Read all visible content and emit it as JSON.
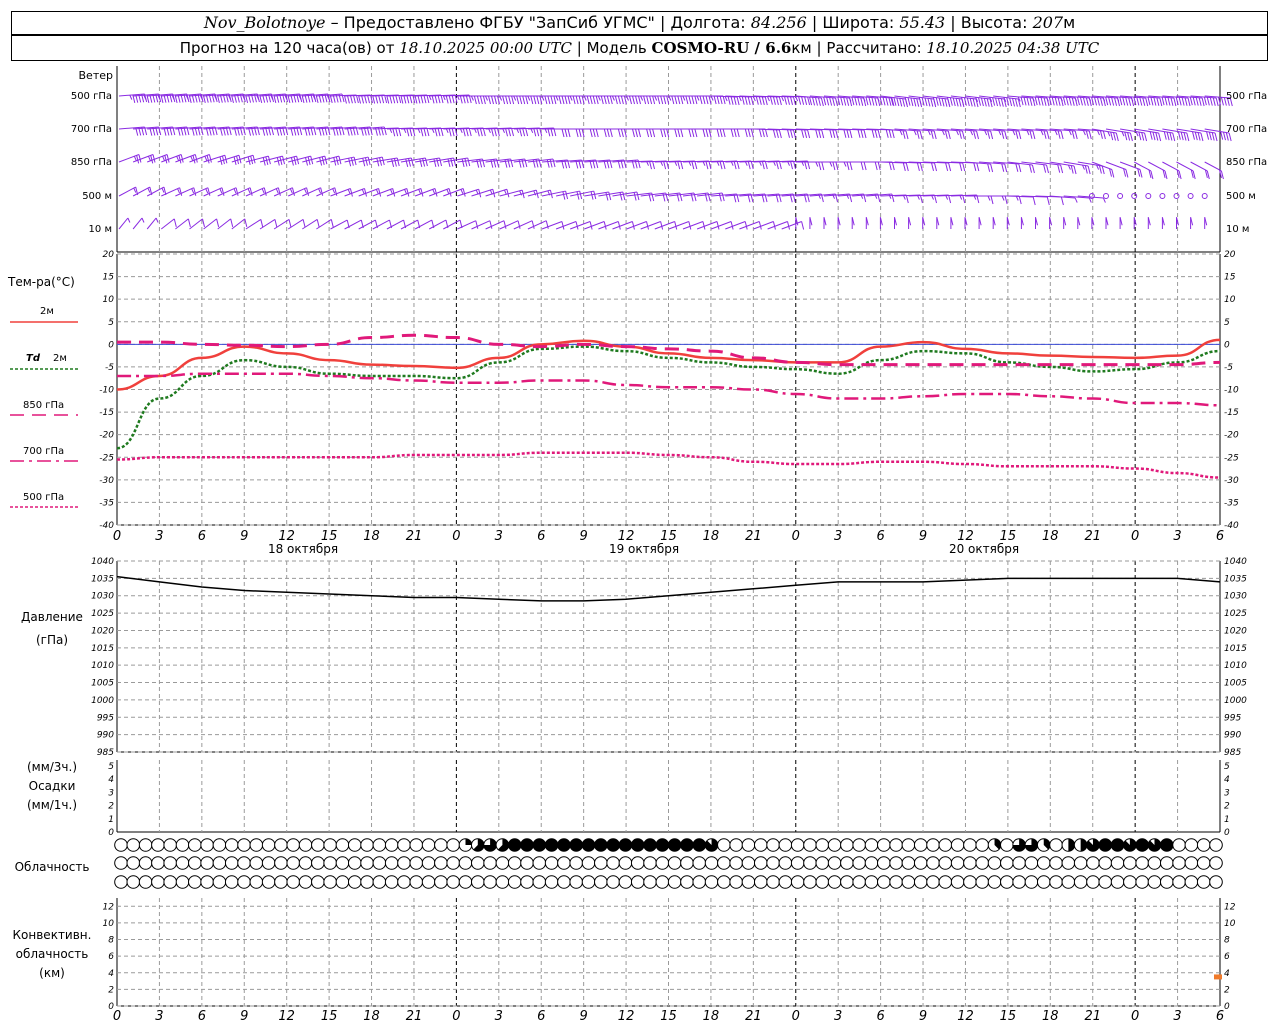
{
  "header": {
    "station": "Nov_Bolotnoye",
    "provider": " – Предоставлено ФГБУ \"ЗапСиб УГМС\" | Долгота: ",
    "lon": "84.256",
    "lat_label": " | Широта: ",
    "lat": "55.43",
    "alt_label": " | Высота: ",
    "alt": "207",
    "alt_unit": "м",
    "forecast_label": "Прогноз на 120 часа(ов) от ",
    "forecast_start": "18.10.2025 00:00 UTC",
    "model_label": " | Модель ",
    "model": "COSMO-RU / 6.6",
    "model_unit": "км",
    "calc_label": " | Рассчитано: ",
    "calc_time": "18.10.2025 04:38 UTC"
  },
  "colors": {
    "wind": "#8a2be2",
    "t2m": "#f0403c",
    "td2m": "#1f7a1f",
    "t850": "#e0197a",
    "t700": "#e0197a",
    "t500": "#e0197a",
    "pressure": "#000000",
    "zero_line": "#3b4bd6",
    "grid": "#9a9a9a",
    "convective": "#f07a2a"
  },
  "labels": {
    "wind": "Ветер",
    "temp": "Тем-ра(°С)",
    "t2m": "2м",
    "td": "Td",
    "td_h": "2м",
    "t850": "850 гПа",
    "t700": "700 гПа",
    "t500": "500 гПа",
    "pressure_1": "Давление",
    "pressure_2": "(гПа)",
    "precip_1": "(мм/3ч.)",
    "precip_2": "Осадки",
    "precip_3": "(мм/1ч.)",
    "cloud": "Облачность",
    "conv_1": "Конвективн.",
    "conv_2": "облачность",
    "conv_3": "(км)"
  },
  "wind_levels": [
    "500 гПа",
    "700 гПа",
    "850 гПа",
    "500 м",
    "10 м"
  ],
  "x_hours": [
    "0",
    "3",
    "6",
    "9",
    "12",
    "15",
    "18",
    "21",
    "0",
    "3",
    "6",
    "9",
    "12",
    "15",
    "18",
    "21",
    "0",
    "3",
    "6",
    "9",
    "12",
    "15",
    "18",
    "21",
    "0",
    "3",
    "6"
  ],
  "dates": [
    "18 октября",
    "19 октября",
    "20 октября"
  ],
  "chart_data": [
    {
      "type": "line",
      "title": "Температура",
      "ylabel": "Тем-ра(°С)",
      "ylim": [
        -40,
        20
      ],
      "yticks": [
        20,
        15,
        10,
        5,
        0,
        -5,
        -10,
        -15,
        -20,
        -25,
        -30,
        -35,
        -40
      ],
      "x_hours_from_start": [
        0,
        3,
        6,
        9,
        12,
        15,
        18,
        21,
        24,
        27,
        30,
        33,
        36,
        39,
        42,
        45,
        48,
        51,
        54,
        57,
        60,
        63,
        66,
        69,
        72,
        75,
        78
      ],
      "series": [
        {
          "name": "2м",
          "values": [
            -10,
            -7,
            -3,
            -0.5,
            -2,
            -3.5,
            -4.5,
            -4.8,
            -5.2,
            -3,
            0,
            0.8,
            -0.5,
            -2,
            -3,
            -3.5,
            -4,
            -4,
            -0.5,
            0.5,
            -1,
            -2,
            -2.5,
            -2.8,
            -3,
            -2.5,
            1
          ]
        },
        {
          "name": "Td 2м",
          "values": [
            -23,
            -12,
            -7,
            -3.5,
            -5,
            -6.5,
            -7,
            -7,
            -7.5,
            -4,
            -1,
            -0.5,
            -1.5,
            -3,
            -4,
            -5,
            -5.5,
            -6.5,
            -3.5,
            -1.5,
            -2,
            -4,
            -5,
            -6,
            -5.5,
            -4,
            -1.5
          ]
        },
        {
          "name": "850 гПа",
          "values": [
            0.5,
            0.5,
            0,
            -0.2,
            -0.5,
            0,
            1.5,
            2,
            1.5,
            0,
            -0.5,
            0,
            -0.5,
            -1,
            -1.5,
            -3,
            -4,
            -4.5,
            -4.5,
            -4.5,
            -4.5,
            -4.5,
            -4.5,
            -4.5,
            -4.5,
            -4.5,
            -4
          ]
        },
        {
          "name": "700 гПа",
          "values": [
            -7,
            -7,
            -6.5,
            -6.5,
            -6.5,
            -7,
            -7.5,
            -8,
            -8.5,
            -8.5,
            -8,
            -8,
            -9,
            -9.5,
            -9.5,
            -10,
            -11,
            -12,
            -12,
            -11.5,
            -11,
            -11,
            -11.5,
            -12,
            -13,
            -13,
            -13.5
          ]
        },
        {
          "name": "500 гПа",
          "values": [
            -25.5,
            -25,
            -25,
            -25,
            -25,
            -25,
            -25,
            -24.5,
            -24.5,
            -24.5,
            -24,
            -24,
            -24,
            -24.5,
            -25,
            -26,
            -26.5,
            -26.5,
            -26,
            -26,
            -26.5,
            -27,
            -27,
            -27,
            -27.5,
            -28.5,
            -29.5
          ]
        }
      ]
    },
    {
      "type": "line",
      "title": "Давление",
      "ylabel": "Давление (гПа)",
      "ylim": [
        985,
        1040
      ],
      "yticks": [
        1040,
        1035,
        1030,
        1025,
        1020,
        1015,
        1010,
        1005,
        1000,
        995,
        990,
        985
      ],
      "x_hours_from_start": [
        0,
        3,
        6,
        9,
        12,
        15,
        18,
        21,
        24,
        27,
        30,
        33,
        36,
        39,
        42,
        45,
        48,
        51,
        54,
        57,
        60,
        63,
        66,
        69,
        72,
        75,
        78
      ],
      "series": [
        {
          "name": "Давление",
          "values": [
            1035.5,
            1034,
            1032.5,
            1031.5,
            1031,
            1030.5,
            1030,
            1029.5,
            1029.5,
            1029,
            1028.5,
            1028.5,
            1029,
            1030,
            1031,
            1032,
            1033,
            1034,
            1034,
            1034,
            1034.5,
            1035,
            1035,
            1035,
            1035,
            1035,
            1034
          ]
        }
      ]
    },
    {
      "type": "bar",
      "title": "Осадки",
      "ylabel": "(мм/3ч.) Осадки (мм/1ч.)",
      "ylim": [
        0,
        5
      ],
      "yticks": [
        5,
        4,
        3,
        2,
        1,
        0
      ],
      "values": []
    },
    {
      "type": "bar",
      "title": "Конвективн. облачность",
      "ylabel": "(км)",
      "ylim": [
        0,
        13
      ],
      "yticks": [
        12,
        10,
        8,
        6,
        4,
        2,
        0
      ],
      "bars": [
        {
          "x_hour": 78,
          "bottom": 3.2,
          "top": 3.8
        }
      ]
    }
  ],
  "wind_barbs": {
    "note_levels": [
      "500 гПа",
      "700 гПа",
      "850 гПа",
      "500 м",
      "10 м"
    ],
    "rows": [
      {
        "level": "500 гПа",
        "speed": [
          55,
          55,
          55,
          55,
          55,
          50,
          50,
          45,
          45,
          45,
          45,
          45,
          45,
          45,
          45,
          45,
          50,
          55,
          60,
          60,
          55,
          55,
          55,
          55,
          50,
          50,
          55
        ],
        "dir": [
          260,
          260,
          260,
          260,
          260,
          265,
          265,
          265,
          270,
          270,
          270,
          270,
          270,
          270,
          275,
          275,
          280,
          280,
          285,
          285,
          285,
          280,
          280,
          280,
          280,
          280,
          280
        ]
      },
      {
        "level": "700 гПа",
        "speed": [
          40,
          40,
          40,
          40,
          40,
          40,
          35,
          35,
          35,
          35,
          30,
          30,
          30,
          30,
          30,
          30,
          30,
          30,
          25,
          25,
          25,
          25,
          25,
          35,
          40,
          40,
          40
        ],
        "dir": [
          260,
          260,
          260,
          260,
          260,
          260,
          265,
          265,
          265,
          265,
          270,
          270,
          270,
          270,
          270,
          275,
          275,
          275,
          280,
          280,
          280,
          280,
          280,
          290,
          290,
          290,
          285
        ]
      },
      {
        "level": "850 гПа",
        "speed": [
          25,
          25,
          30,
          30,
          30,
          30,
          30,
          30,
          30,
          30,
          30,
          30,
          25,
          25,
          25,
          25,
          25,
          20,
          20,
          20,
          20,
          20,
          25,
          20,
          20,
          20,
          15
        ],
        "dir": [
          230,
          230,
          235,
          240,
          240,
          245,
          250,
          250,
          255,
          255,
          260,
          260,
          265,
          265,
          265,
          265,
          270,
          270,
          275,
          275,
          280,
          285,
          290,
          310,
          320,
          320,
          315
        ]
      },
      {
        "level": "500 м",
        "speed": [
          15,
          15,
          15,
          15,
          15,
          15,
          15,
          15,
          15,
          15,
          20,
          20,
          20,
          20,
          20,
          20,
          15,
          15,
          15,
          15,
          15,
          10,
          5,
          0,
          0,
          0,
          5
        ],
        "dir": [
          220,
          225,
          225,
          225,
          225,
          230,
          230,
          230,
          235,
          240,
          245,
          250,
          255,
          255,
          260,
          260,
          260,
          260,
          265,
          265,
          270,
          275,
          280,
          0,
          0,
          0,
          320
        ]
      },
      {
        "level": "10 м",
        "speed": [
          5,
          10,
          10,
          10,
          10,
          10,
          10,
          10,
          10,
          10,
          10,
          10,
          10,
          10,
          10,
          10,
          10,
          10,
          10,
          10,
          10,
          10,
          10,
          10,
          10,
          10,
          5
        ],
        "dir": [
          200,
          210,
          210,
          215,
          215,
          220,
          220,
          220,
          225,
          225,
          230,
          230,
          230,
          230,
          230,
          230,
          180,
          180,
          180,
          180,
          180,
          180,
          180,
          180,
          180,
          180,
          200
        ]
      }
    ]
  },
  "cloud_cover": {
    "rows": [
      {
        "layer": "upper",
        "values": [
          0,
          0,
          0,
          0,
          0,
          0,
          0,
          0,
          0,
          0,
          0,
          0,
          0,
          0,
          0,
          0,
          0,
          0,
          0,
          0,
          0,
          0,
          0,
          0,
          0,
          0,
          0,
          0,
          0,
          0,
          0,
          0,
          0,
          0,
          0,
          0,
          0,
          0,
          0,
          0,
          0,
          0,
          0,
          0,
          0,
          0,
          0,
          0,
          0,
          0,
          0,
          0,
          0,
          0,
          0,
          0,
          0,
          0,
          0,
          0,
          0,
          0,
          0,
          0,
          0,
          0,
          0,
          0,
          0,
          0,
          0,
          0,
          0,
          0,
          0,
          0,
          0,
          0,
          0,
          0,
          0,
          0,
          0,
          0,
          0,
          0,
          0,
          0,
          0,
          0,
          0,
          0,
          0,
          0,
          0,
          0,
          0,
          0,
          0,
          0,
          0,
          0,
          0,
          0,
          0,
          0,
          0,
          0,
          0,
          0,
          0,
          0,
          0,
          0,
          0,
          0,
          0,
          0,
          0,
          0,
          0
        ]
      },
      {
        "layer": "middle",
        "values": [
          0,
          0,
          0,
          0,
          0,
          0,
          0,
          0,
          0,
          0,
          0,
          0,
          0,
          0,
          0,
          0,
          0,
          0,
          0,
          0,
          0,
          0,
          0,
          0,
          0,
          0,
          0,
          0,
          0,
          0,
          0,
          0,
          0,
          0,
          0,
          0,
          0,
          0,
          0,
          0,
          0,
          0,
          0,
          0,
          0,
          0,
          0,
          0,
          0,
          0,
          0,
          0,
          0,
          0,
          0,
          0,
          0,
          0,
          0,
          0,
          0,
          0,
          0,
          0,
          0,
          0,
          0,
          0,
          0,
          0,
          0,
          0,
          0,
          0,
          0,
          0,
          0,
          0,
          0,
          0,
          0,
          0,
          0,
          0,
          0,
          0,
          0,
          0,
          0,
          0,
          0,
          0,
          0,
          0,
          0,
          0,
          0,
          0,
          0,
          0,
          0,
          0,
          0,
          0,
          0,
          0,
          0,
          0,
          0,
          0,
          0,
          0,
          0,
          0,
          0,
          0,
          0,
          0,
          0,
          0,
          0
        ]
      },
      {
        "layer": "lower",
        "values": [
          0,
          0,
          0,
          0,
          0,
          0,
          0,
          0,
          0,
          0,
          0,
          0,
          0,
          0,
          0,
          0,
          0,
          0,
          0,
          0,
          0,
          0,
          0,
          0,
          0,
          0,
          0,
          0,
          0,
          0,
          0,
          0,
          0,
          0,
          0,
          0,
          0,
          0,
          0,
          0,
          0,
          0,
          0,
          0,
          0,
          0,
          0,
          0,
          0,
          0,
          0,
          0,
          0,
          0,
          0,
          0,
          0,
          0,
          0,
          0,
          0,
          0,
          0,
          0,
          0,
          0,
          0,
          0,
          0,
          0,
          0,
          0,
          0,
          0,
          0,
          0,
          0,
          0,
          0,
          0,
          0,
          0,
          0,
          0,
          0,
          0,
          0,
          0,
          0,
          0,
          0,
          0,
          0,
          0,
          0,
          0,
          0,
          0,
          0,
          0,
          0,
          0,
          0,
          0,
          0,
          0,
          0,
          0,
          0,
          0,
          0,
          0,
          0,
          0,
          0,
          0,
          0,
          0,
          0,
          0,
          0
        ]
      }
    ],
    "upper_octas": [
      0,
      0,
      0,
      0,
      0,
      0,
      0,
      0,
      0,
      0,
      0,
      0,
      0,
      0,
      0,
      0,
      0,
      0,
      0,
      0,
      0,
      0,
      0,
      0,
      0,
      0,
      0,
      0,
      0,
      0,
      0,
      0,
      0,
      0,
      0,
      0,
      2,
      5,
      7,
      6,
      5,
      8,
      7,
      8,
      8,
      8,
      7,
      8,
      8,
      8,
      8,
      8,
      8,
      8,
      8,
      8,
      8,
      8,
      8,
      8,
      7,
      8,
      7,
      0,
      0,
      0,
      0,
      0,
      0,
      0,
      0,
      0,
      0,
      0,
      0,
      0,
      0,
      0,
      0,
      0,
      0,
      0,
      0,
      0,
      0,
      0,
      0,
      0,
      0,
      0,
      0,
      0,
      3,
      0,
      6,
      7,
      6,
      3,
      0,
      4,
      7,
      4,
      7,
      8,
      5,
      8,
      7,
      8,
      8,
      7,
      8,
      0,
      0,
      0,
      0,
      0
    ],
    "middle_octas": [
      0,
      0,
      0,
      0,
      0,
      0,
      0,
      0,
      0,
      0,
      0,
      0,
      0,
      0,
      0,
      0,
      0,
      0,
      0,
      0,
      0,
      0,
      0,
      0,
      0,
      0,
      0,
      0,
      0,
      0,
      0,
      0,
      0,
      0,
      0,
      0,
      0,
      0,
      0,
      0,
      0,
      0,
      0,
      0,
      0,
      0,
      0,
      0,
      0,
      0,
      0,
      0,
      0,
      0,
      0,
      0,
      0,
      0,
      0,
      0,
      0,
      0,
      0,
      0,
      0,
      0,
      0,
      0,
      0,
      0,
      0,
      0,
      0,
      0,
      0,
      0,
      0,
      0,
      0,
      0,
      0,
      0,
      0,
      0,
      0,
      0,
      0,
      0,
      0,
      0,
      0,
      0,
      0,
      0,
      0,
      0,
      0,
      0,
      0,
      0,
      0,
      0,
      0,
      0,
      0,
      0,
      0,
      0,
      0,
      0,
      0,
      0,
      0,
      0,
      0,
      0,
      0,
      0,
      0,
      0,
      0
    ],
    "lower_octas": [
      0,
      0,
      0,
      0,
      0,
      0,
      0,
      0,
      0,
      0,
      0,
      0,
      0,
      0,
      0,
      0,
      0,
      0,
      0,
      0,
      0,
      0,
      0,
      0,
      0,
      0,
      0,
      0,
      0,
      0,
      0,
      0,
      0,
      0,
      0,
      0,
      0,
      0,
      0,
      0,
      0,
      0,
      0,
      0,
      0,
      0,
      0,
      0,
      0,
      0,
      0,
      0,
      0,
      0,
      0,
      0,
      0,
      0,
      0,
      0,
      0,
      0,
      0,
      0,
      0,
      0,
      0,
      0,
      0,
      0,
      0,
      0,
      0,
      0,
      0,
      0,
      0,
      0,
      0,
      0,
      0,
      0,
      0,
      0,
      0,
      0,
      0,
      0,
      0,
      0,
      0,
      0,
      0,
      0,
      0,
      0,
      0,
      0,
      0,
      0,
      0,
      0,
      0,
      0,
      0,
      0,
      0,
      0,
      0,
      0,
      0,
      0,
      0,
      0,
      0,
      0,
      0,
      0,
      0,
      0,
      0
    ]
  }
}
